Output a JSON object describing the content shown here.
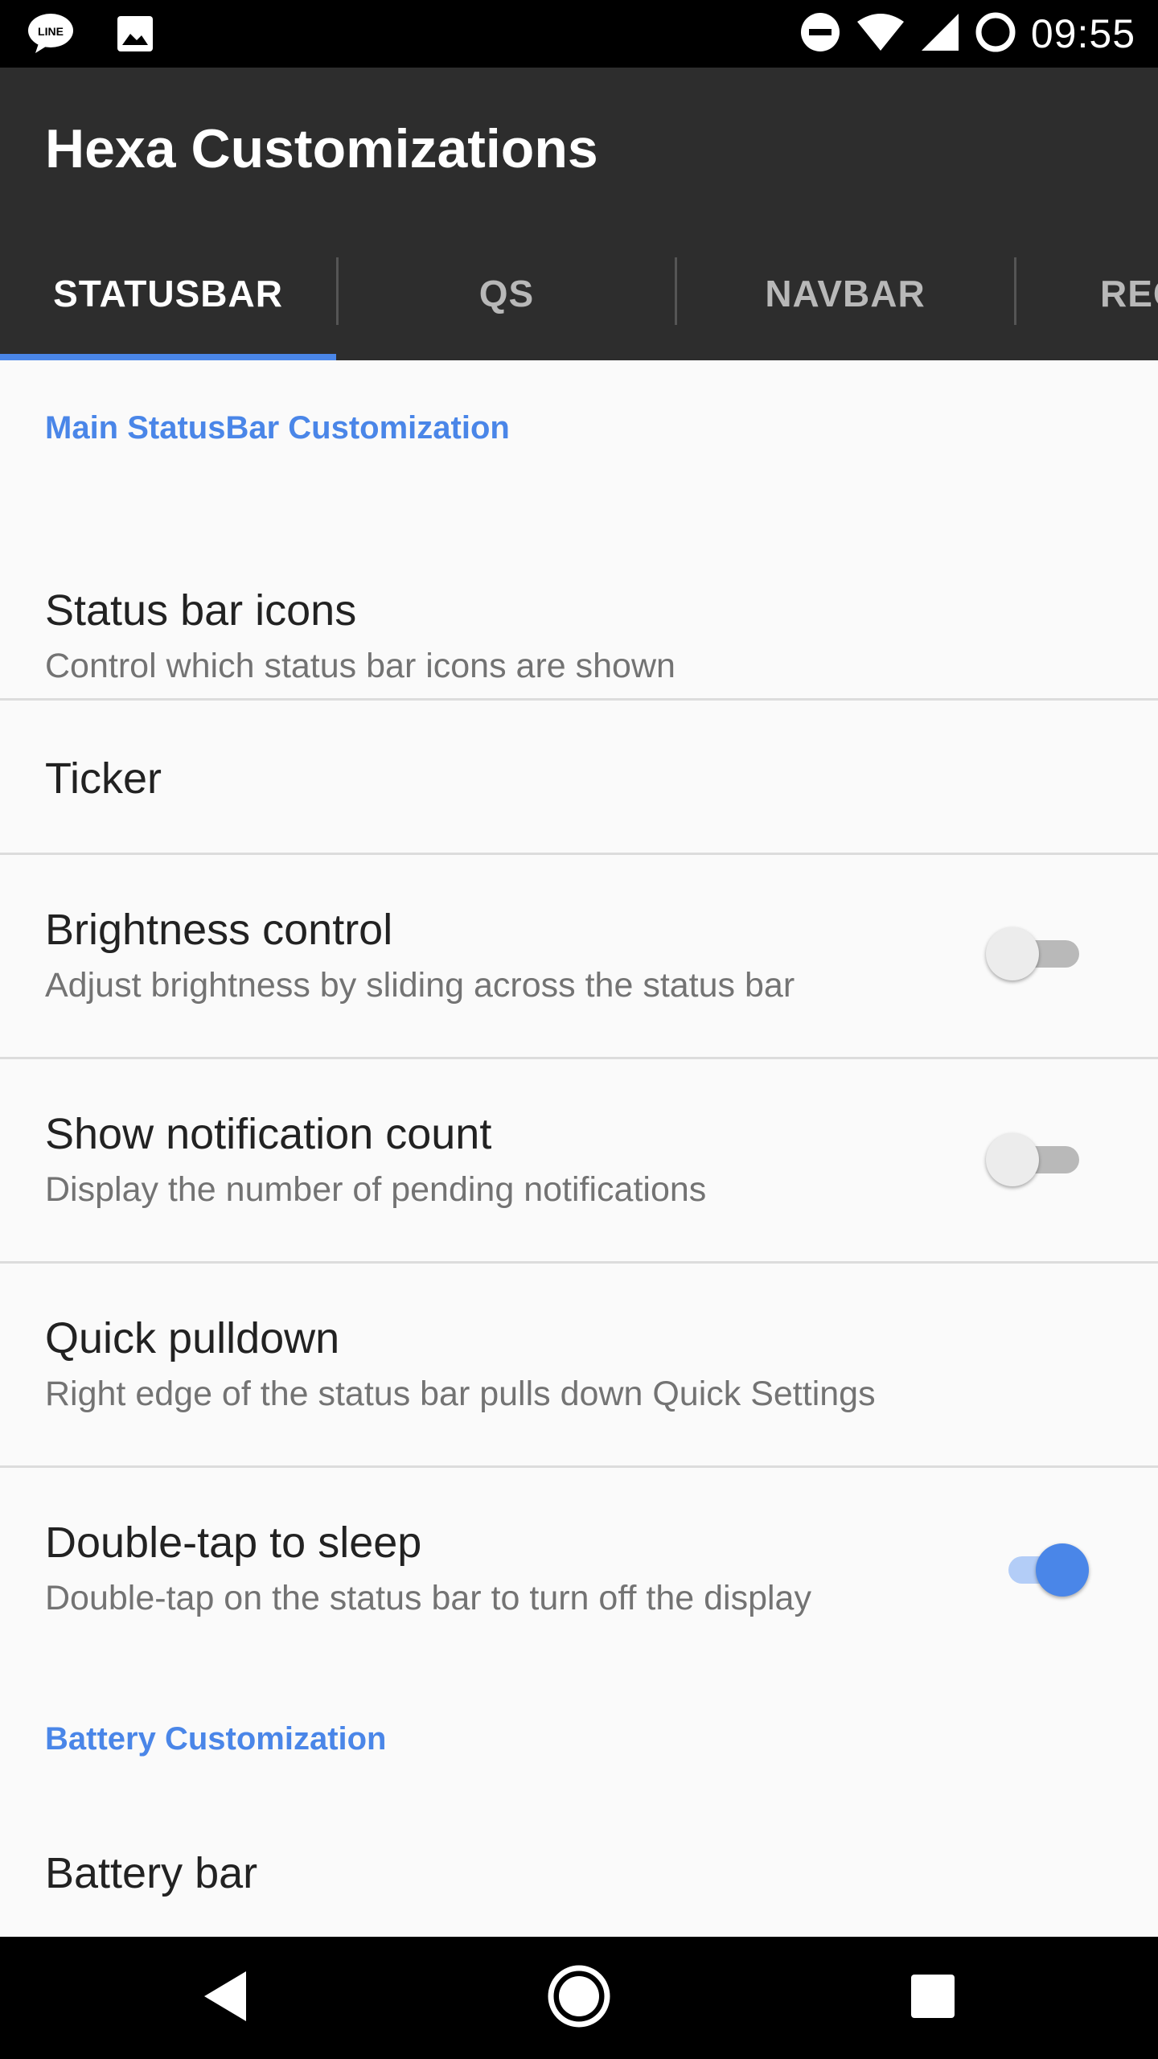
{
  "status_bar": {
    "time": "09:55",
    "left_icons": [
      "line-app-icon",
      "gallery-icon"
    ],
    "right_icons": [
      "do-not-disturb-icon",
      "wifi-icon",
      "cell-signal-icon",
      "battery-saver-icon"
    ]
  },
  "toolbar": {
    "title": "Hexa Customizations"
  },
  "tabs": [
    {
      "label": "STATUSBAR",
      "active": true
    },
    {
      "label": "QS",
      "active": false
    },
    {
      "label": "NAVBAR",
      "active": false
    },
    {
      "label": "REC",
      "active": false
    }
  ],
  "sections": {
    "main": {
      "header": "Main StatusBar Customization"
    },
    "battery": {
      "header": "Battery Customization"
    }
  },
  "prefs": [
    {
      "title": "Status bar icons",
      "summary": "Control which status bar icons are shown"
    },
    {
      "title": "Ticker",
      "summary": ""
    },
    {
      "title": "Brightness control",
      "summary": "Adjust brightness by sliding across the status bar",
      "checked": false
    },
    {
      "title": "Show notification count",
      "summary": "Display the number of pending notifications",
      "checked": false
    },
    {
      "title": "Quick pulldown",
      "summary": "Right edge of the status bar pulls down Quick Settings"
    },
    {
      "title": "Double-tap to sleep",
      "summary": "Double-tap on the status bar to turn off the display",
      "checked": true
    },
    {
      "title": "Battery bar",
      "summary": ""
    }
  ],
  "nav_bar": {
    "buttons": [
      "back-icon",
      "home-icon",
      "recents-icon"
    ]
  },
  "colors": {
    "accent": "#4a86e8",
    "toolbar": "#2d2d2d",
    "background": "#fafafa"
  }
}
